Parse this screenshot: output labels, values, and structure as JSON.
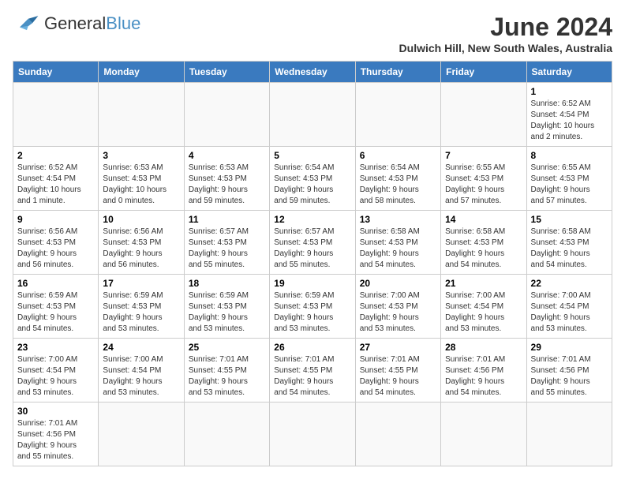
{
  "header": {
    "logo_general": "General",
    "logo_blue": "Blue",
    "month_title": "June 2024",
    "location": "Dulwich Hill, New South Wales, Australia"
  },
  "days_of_week": [
    "Sunday",
    "Monday",
    "Tuesday",
    "Wednesday",
    "Thursday",
    "Friday",
    "Saturday"
  ],
  "weeks": [
    [
      {
        "day": "",
        "info": ""
      },
      {
        "day": "",
        "info": ""
      },
      {
        "day": "",
        "info": ""
      },
      {
        "day": "",
        "info": ""
      },
      {
        "day": "",
        "info": ""
      },
      {
        "day": "",
        "info": ""
      },
      {
        "day": "1",
        "info": "Sunrise: 6:52 AM\nSunset: 4:54 PM\nDaylight: 10 hours\nand 2 minutes."
      }
    ],
    [
      {
        "day": "2",
        "info": "Sunrise: 6:52 AM\nSunset: 4:54 PM\nDaylight: 10 hours\nand 1 minute."
      },
      {
        "day": "3",
        "info": "Sunrise: 6:53 AM\nSunset: 4:53 PM\nDaylight: 10 hours\nand 0 minutes."
      },
      {
        "day": "4",
        "info": "Sunrise: 6:53 AM\nSunset: 4:53 PM\nDaylight: 9 hours\nand 59 minutes."
      },
      {
        "day": "5",
        "info": "Sunrise: 6:54 AM\nSunset: 4:53 PM\nDaylight: 9 hours\nand 59 minutes."
      },
      {
        "day": "6",
        "info": "Sunrise: 6:54 AM\nSunset: 4:53 PM\nDaylight: 9 hours\nand 58 minutes."
      },
      {
        "day": "7",
        "info": "Sunrise: 6:55 AM\nSunset: 4:53 PM\nDaylight: 9 hours\nand 57 minutes."
      },
      {
        "day": "8",
        "info": "Sunrise: 6:55 AM\nSunset: 4:53 PM\nDaylight: 9 hours\nand 57 minutes."
      }
    ],
    [
      {
        "day": "9",
        "info": "Sunrise: 6:56 AM\nSunset: 4:53 PM\nDaylight: 9 hours\nand 56 minutes."
      },
      {
        "day": "10",
        "info": "Sunrise: 6:56 AM\nSunset: 4:53 PM\nDaylight: 9 hours\nand 56 minutes."
      },
      {
        "day": "11",
        "info": "Sunrise: 6:57 AM\nSunset: 4:53 PM\nDaylight: 9 hours\nand 55 minutes."
      },
      {
        "day": "12",
        "info": "Sunrise: 6:57 AM\nSunset: 4:53 PM\nDaylight: 9 hours\nand 55 minutes."
      },
      {
        "day": "13",
        "info": "Sunrise: 6:58 AM\nSunset: 4:53 PM\nDaylight: 9 hours\nand 54 minutes."
      },
      {
        "day": "14",
        "info": "Sunrise: 6:58 AM\nSunset: 4:53 PM\nDaylight: 9 hours\nand 54 minutes."
      },
      {
        "day": "15",
        "info": "Sunrise: 6:58 AM\nSunset: 4:53 PM\nDaylight: 9 hours\nand 54 minutes."
      }
    ],
    [
      {
        "day": "16",
        "info": "Sunrise: 6:59 AM\nSunset: 4:53 PM\nDaylight: 9 hours\nand 54 minutes."
      },
      {
        "day": "17",
        "info": "Sunrise: 6:59 AM\nSunset: 4:53 PM\nDaylight: 9 hours\nand 53 minutes."
      },
      {
        "day": "18",
        "info": "Sunrise: 6:59 AM\nSunset: 4:53 PM\nDaylight: 9 hours\nand 53 minutes."
      },
      {
        "day": "19",
        "info": "Sunrise: 6:59 AM\nSunset: 4:53 PM\nDaylight: 9 hours\nand 53 minutes."
      },
      {
        "day": "20",
        "info": "Sunrise: 7:00 AM\nSunset: 4:53 PM\nDaylight: 9 hours\nand 53 minutes."
      },
      {
        "day": "21",
        "info": "Sunrise: 7:00 AM\nSunset: 4:54 PM\nDaylight: 9 hours\nand 53 minutes."
      },
      {
        "day": "22",
        "info": "Sunrise: 7:00 AM\nSunset: 4:54 PM\nDaylight: 9 hours\nand 53 minutes."
      }
    ],
    [
      {
        "day": "23",
        "info": "Sunrise: 7:00 AM\nSunset: 4:54 PM\nDaylight: 9 hours\nand 53 minutes."
      },
      {
        "day": "24",
        "info": "Sunrise: 7:00 AM\nSunset: 4:54 PM\nDaylight: 9 hours\nand 53 minutes."
      },
      {
        "day": "25",
        "info": "Sunrise: 7:01 AM\nSunset: 4:55 PM\nDaylight: 9 hours\nand 53 minutes."
      },
      {
        "day": "26",
        "info": "Sunrise: 7:01 AM\nSunset: 4:55 PM\nDaylight: 9 hours\nand 54 minutes."
      },
      {
        "day": "27",
        "info": "Sunrise: 7:01 AM\nSunset: 4:55 PM\nDaylight: 9 hours\nand 54 minutes."
      },
      {
        "day": "28",
        "info": "Sunrise: 7:01 AM\nSunset: 4:56 PM\nDaylight: 9 hours\nand 54 minutes."
      },
      {
        "day": "29",
        "info": "Sunrise: 7:01 AM\nSunset: 4:56 PM\nDaylight: 9 hours\nand 55 minutes."
      }
    ],
    [
      {
        "day": "30",
        "info": "Sunrise: 7:01 AM\nSunset: 4:56 PM\nDaylight: 9 hours\nand 55 minutes."
      },
      {
        "day": "",
        "info": ""
      },
      {
        "day": "",
        "info": ""
      },
      {
        "day": "",
        "info": ""
      },
      {
        "day": "",
        "info": ""
      },
      {
        "day": "",
        "info": ""
      },
      {
        "day": "",
        "info": ""
      }
    ]
  ]
}
